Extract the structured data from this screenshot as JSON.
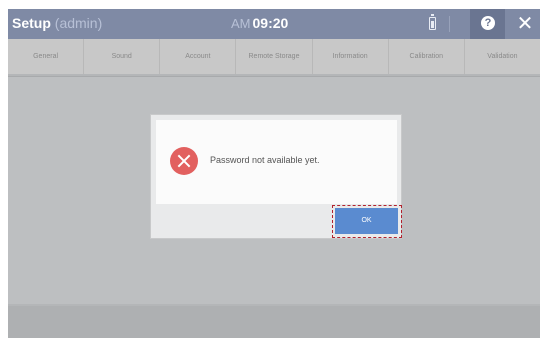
{
  "titlebar": {
    "title": "Setup",
    "role": "(admin)",
    "ampm": "AM",
    "time": "09:20"
  },
  "icons": {
    "battery": "battery-icon",
    "help": "help-icon",
    "close": "close-icon",
    "error": "error-icon"
  },
  "tabs": [
    "General",
    "Sound",
    "Account",
    "Remote Storage",
    "Information",
    "Calibration",
    "Validation"
  ],
  "dialog": {
    "message": "Password not available yet.",
    "ok_label": "OK"
  },
  "colors": {
    "titlebar": "#7f8aa5",
    "error": "#e2605f",
    "ok_button": "#5a8bd0",
    "focus_ring": "#b2222e"
  }
}
